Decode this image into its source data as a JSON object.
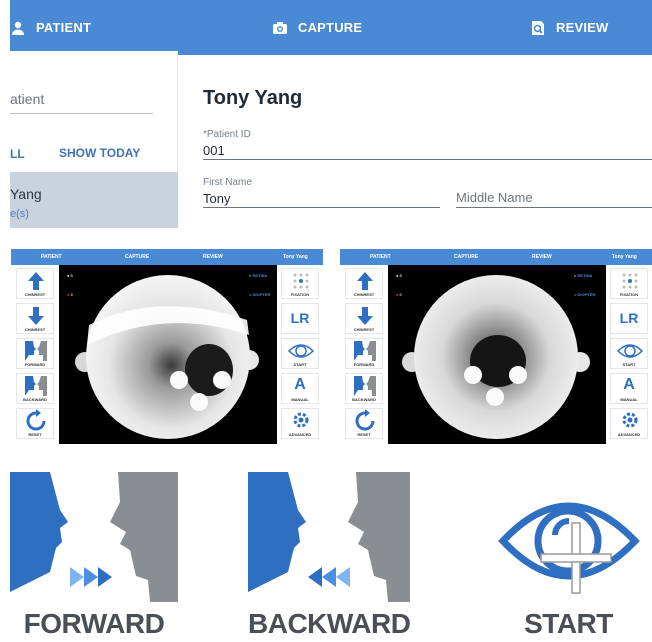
{
  "app": {
    "tabs": [
      {
        "label": "PATIENT",
        "icon": "person-icon"
      },
      {
        "label": "CAPTURE",
        "icon": "camera-icon"
      },
      {
        "label": "REVIEW",
        "icon": "search-document-icon"
      }
    ],
    "sidebar": {
      "search_placeholder": "atient",
      "filter_all": "LL",
      "filter_today": "SHOW TODAY",
      "selected_patient_name": "Yang",
      "selected_patient_sub": "e(s)"
    },
    "patient": {
      "name": "Tony Yang",
      "id_label": "*Patient ID",
      "id_value": "001",
      "first_name_label": "First Name",
      "first_name_value": "Tony",
      "middle_name_placeholder": "Middle Name"
    }
  },
  "capture_screens": [
    {
      "tabs": [
        "PATIENT",
        "CAPTURE",
        "REVIEW"
      ],
      "patient_name": "Tony Yang",
      "left_buttons": [
        "CHINREST",
        "CHINREST",
        "FORWARD",
        "BACKWARD",
        "RESET"
      ],
      "right_buttons": [
        "FIXATION",
        "LR",
        "START",
        "MANUAL",
        "ADVANCED"
      ],
      "manual_glyph": "A",
      "indicators": {
        "top_left": "5",
        "bottom_left": "0",
        "retina": "RETINA",
        "diopter": "DIOPTER"
      }
    },
    {
      "tabs": [
        "PATIENT",
        "CAPTURE",
        "REVIEW"
      ],
      "patient_name": "Tony Yang",
      "left_buttons": [
        "CHINREST",
        "CHINREST",
        "FORWARD",
        "BACKWARD",
        "RESET"
      ],
      "right_buttons": [
        "FIXATION",
        "LR",
        "START",
        "MANUAL",
        "ADVANCED"
      ],
      "manual_glyph": "A",
      "indicators": {
        "top_left": "5",
        "bottom_left": "0",
        "retina": "RETINA",
        "diopter": "DIOPTER"
      }
    }
  ],
  "big_buttons": [
    {
      "label": "FORWARD",
      "icon": "forward-face-icon"
    },
    {
      "label": "BACKWARD",
      "icon": "backward-face-icon"
    },
    {
      "label": "START",
      "icon": "eye-crosshair-icon"
    }
  ],
  "colors": {
    "primary": "#4a8ad4",
    "accent_text": "#3f73b6",
    "selected_row": "#c9d3de",
    "face_blue": "#2f6fc1",
    "face_gray": "#8a8d91"
  }
}
